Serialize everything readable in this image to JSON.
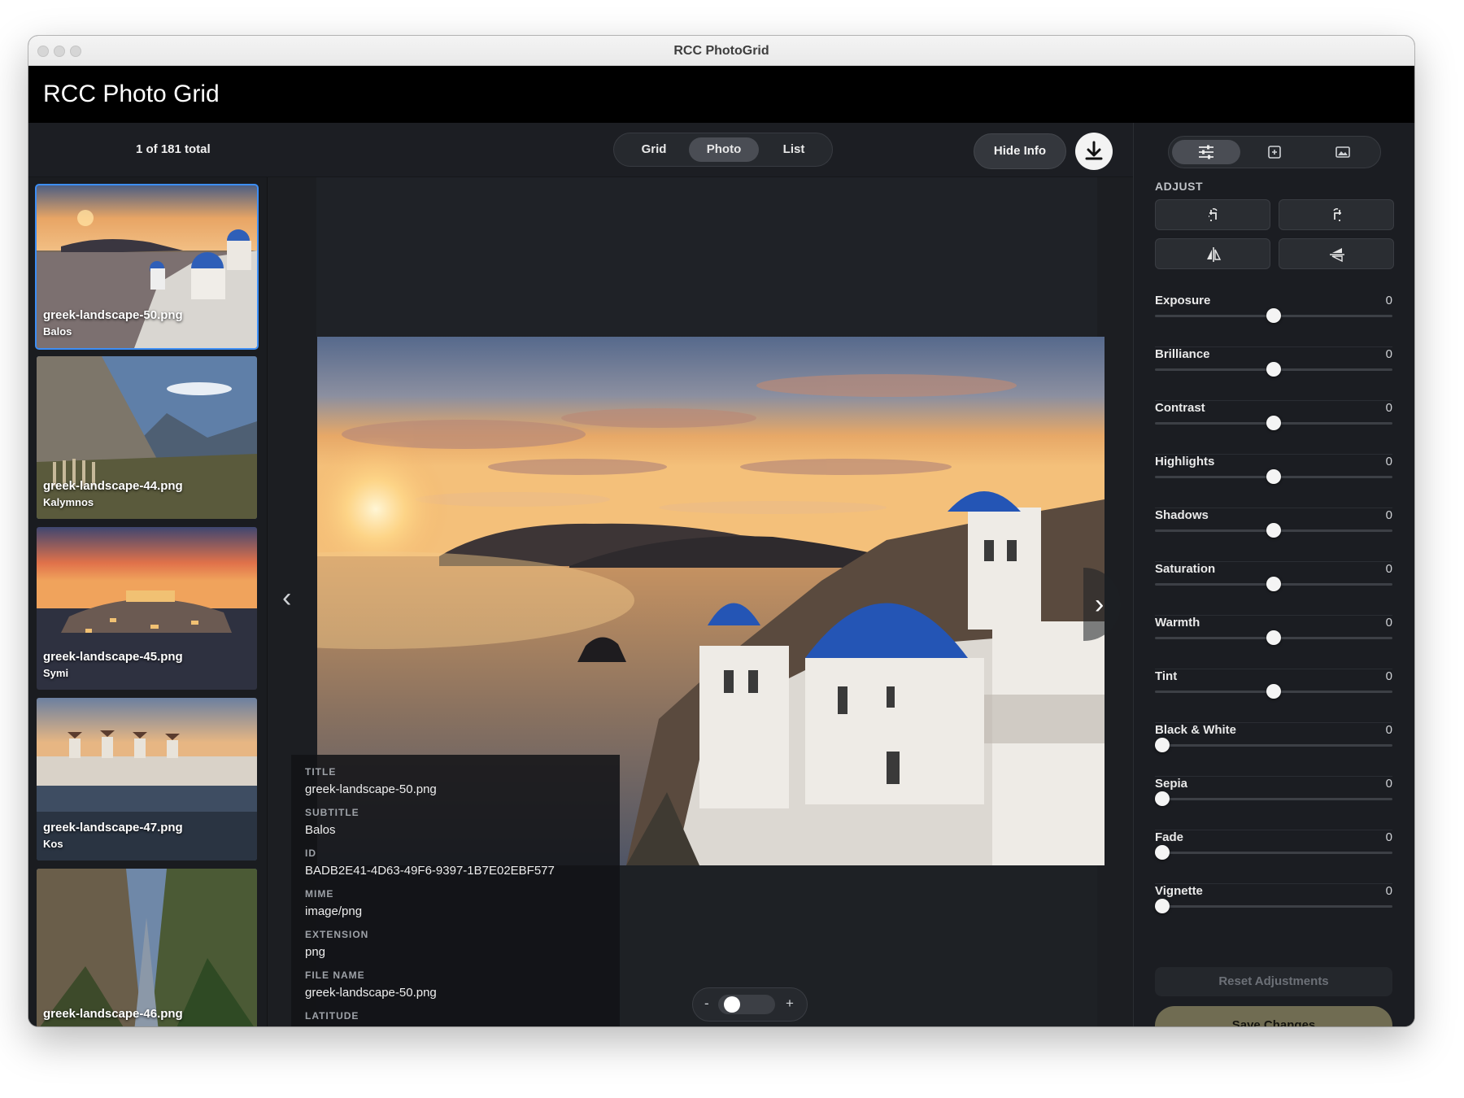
{
  "window": {
    "title": "RCC PhotoGrid"
  },
  "app": {
    "title": "RCC Photo Grid"
  },
  "toolbar": {
    "count_text": "1 of 181 total",
    "views": [
      "Grid",
      "Photo",
      "List"
    ],
    "active_view": "Photo",
    "hide_info_label": "Hide Info",
    "download_icon": "download-icon"
  },
  "thumbnails": [
    {
      "name": "greek-landscape-50.png",
      "subtitle": "Balos",
      "selected": true
    },
    {
      "name": "greek-landscape-44.png",
      "subtitle": "Kalymnos",
      "selected": false
    },
    {
      "name": "greek-landscape-45.png",
      "subtitle": "Symi",
      "selected": false
    },
    {
      "name": "greek-landscape-47.png",
      "subtitle": "Kos",
      "selected": false
    },
    {
      "name": "greek-landscape-46.png",
      "subtitle": "",
      "selected": false
    }
  ],
  "info": {
    "title_label": "TITLE",
    "title": "greek-landscape-50.png",
    "subtitle_label": "SUBTITLE",
    "subtitle": "Balos",
    "id_label": "ID",
    "id": "BADB2E41-4D63-49F6-9397-1B7E02EBF577",
    "mime_label": "MIME",
    "mime": "image/png",
    "extension_label": "EXTENSION",
    "extension": "png",
    "file_name_label": "FILE NAME",
    "file_name": "greek-landscape-50.png",
    "latitude_label": "LATITUDE",
    "latitude": "-"
  },
  "zoom": {
    "minus": "-",
    "plus": "+",
    "level": 0.1
  },
  "panel": {
    "tabs": [
      "sliders-icon",
      "crop-icon",
      "image-adjust-icon"
    ],
    "section_title": "ADJUST",
    "tools": [
      "rotate-left-icon",
      "rotate-right-icon",
      "flip-horizontal-icon",
      "flip-vertical-icon"
    ],
    "adjustments": [
      {
        "label": "Exposure",
        "value": "0",
        "position": 0.5
      },
      {
        "label": "Brilliance",
        "value": "0",
        "position": 0.5
      },
      {
        "label": "Contrast",
        "value": "0",
        "position": 0.5
      },
      {
        "label": "Highlights",
        "value": "0",
        "position": 0.5
      },
      {
        "label": "Shadows",
        "value": "0",
        "position": 0.5
      },
      {
        "label": "Saturation",
        "value": "0",
        "position": 0.5
      },
      {
        "label": "Warmth",
        "value": "0",
        "position": 0.5
      },
      {
        "label": "Tint",
        "value": "0",
        "position": 0.5
      },
      {
        "label": "Black & White",
        "value": "0",
        "position": 0
      },
      {
        "label": "Sepia",
        "value": "0",
        "position": 0
      },
      {
        "label": "Fade",
        "value": "0",
        "position": 0
      },
      {
        "label": "Vignette",
        "value": "0",
        "position": 0
      }
    ],
    "reset_label": "Reset Adjustments",
    "save_label": "Save Changes"
  },
  "colors": {
    "accent": "#3d8ef5",
    "save_button": "#706c52",
    "background": "#1d1f24"
  }
}
